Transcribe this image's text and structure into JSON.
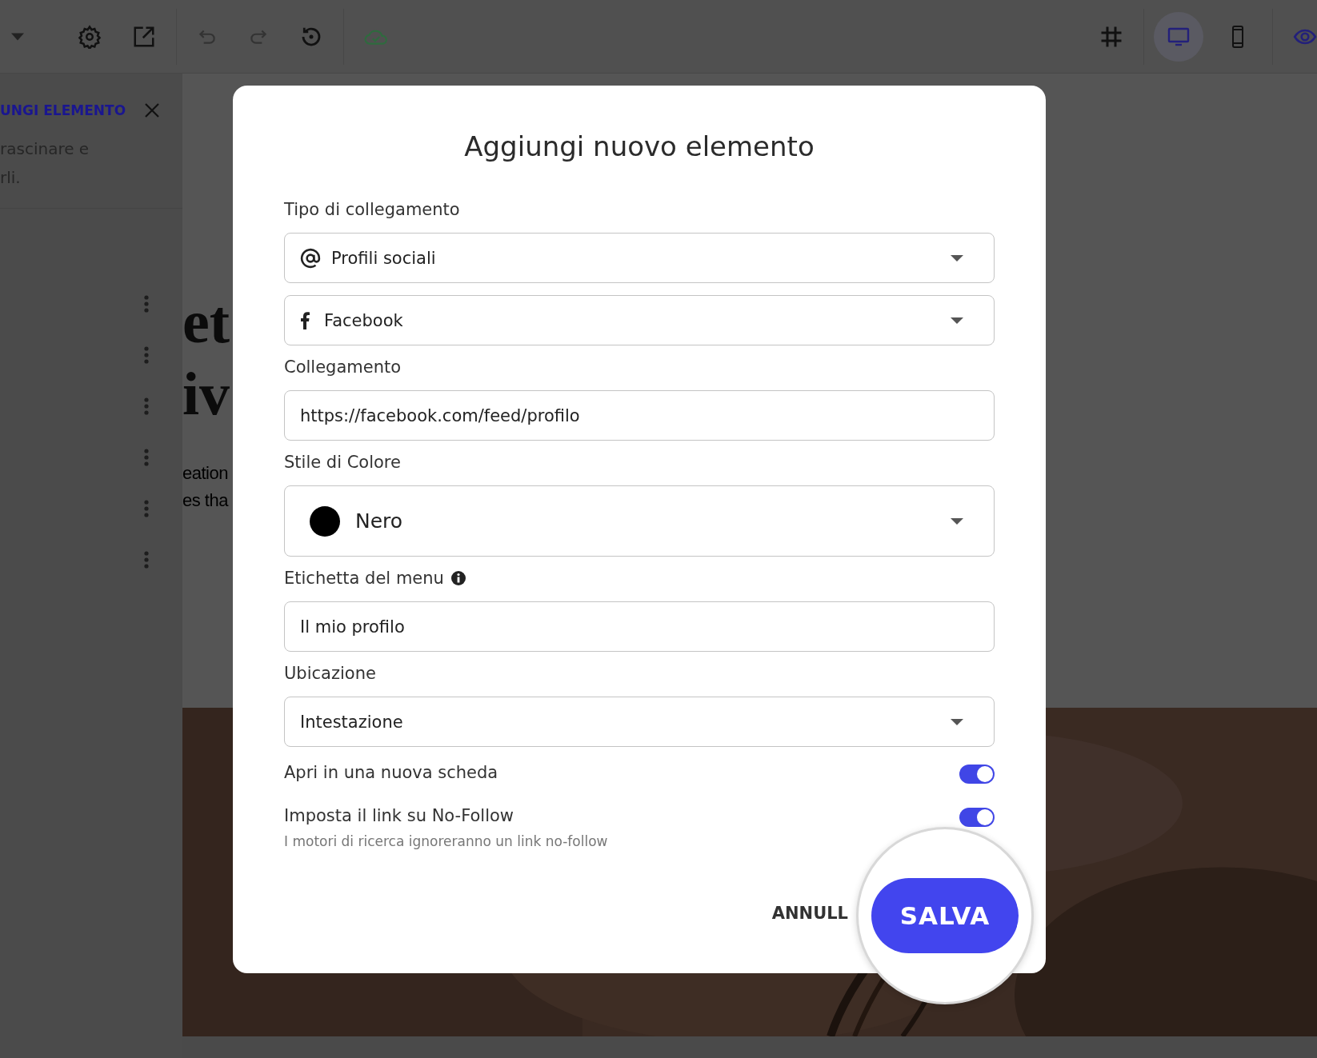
{
  "toolbar": {
    "view_modes": [
      {
        "selected": true
      },
      {
        "selected": false
      }
    ]
  },
  "left_panel": {
    "title": "UNGI ELEMENTO",
    "description_lines": [
      "rascinare e",
      "rli."
    ]
  },
  "canvas": {
    "heading_lines": [
      "et",
      "iv"
    ],
    "body_lines": [
      "eation",
      "es tha"
    ]
  },
  "dialog": {
    "title": "Aggiungi nuovo elemento",
    "fields": [
      {
        "label": "Tipo di collegamento",
        "kind": "select",
        "value": "Profili sociali"
      },
      {
        "kind": "select",
        "value": "Facebook"
      },
      {
        "label": "Collegamento",
        "kind": "input",
        "value": "https://facebook.com/feed/profilo"
      },
      {
        "label": "Stile di Colore",
        "kind": "color",
        "value": "Nero",
        "color": "#000000"
      },
      {
        "label": "Etichetta del menu",
        "info": true,
        "kind": "input",
        "value": "Il mio profilo"
      },
      {
        "label": "Ubicazione",
        "kind": "select",
        "value": "Intestazione"
      }
    ],
    "toggles": [
      {
        "label": "Apri in una nuova scheda",
        "on": true
      },
      {
        "label": "Imposta il link su No-Follow",
        "hint": "I motori di ricerca ignoreranno un link no-follow",
        "on": true
      }
    ],
    "cancel_button": "ANNULL",
    "save_button": "SALVA"
  }
}
